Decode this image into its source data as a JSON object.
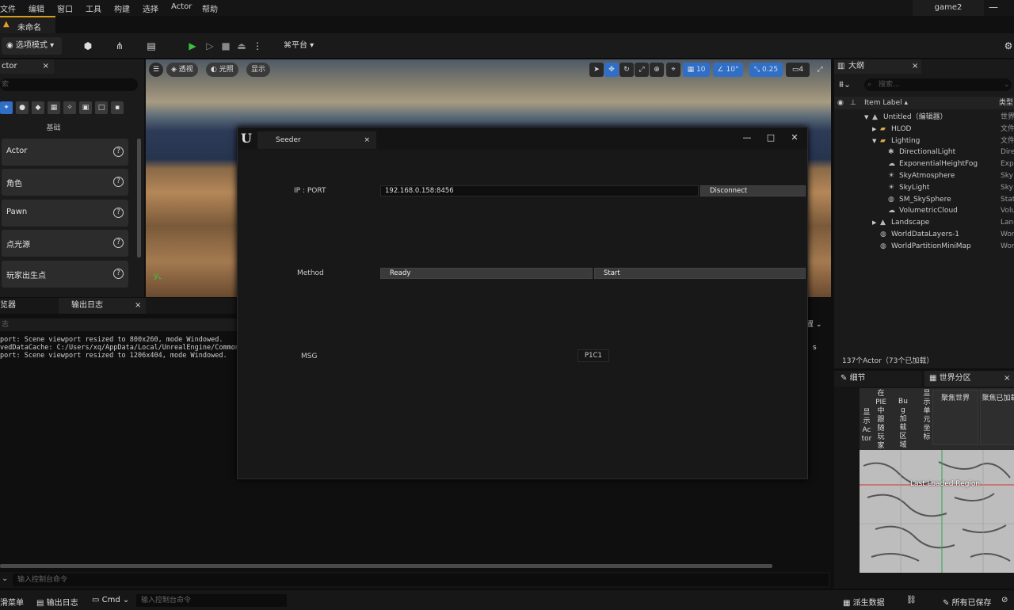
{
  "menubar": {
    "items": [
      "文件",
      "编辑",
      "窗口",
      "工具",
      "构建",
      "选择",
      "Actor",
      "帮助"
    ],
    "project_tab": "game2",
    "minimize": "—"
  },
  "doc_tab": {
    "label": "未命名"
  },
  "toolbar": {
    "mode_label": "选项模式",
    "platform_label": "平台"
  },
  "left_panel": {
    "tab_label": "ctor",
    "search_placeholder": "索",
    "section_label": "基础",
    "items": [
      {
        "label": "Actor"
      },
      {
        "label": "角色"
      },
      {
        "label": "Pawn"
      },
      {
        "label": "点光源"
      },
      {
        "label": "玩家出生点"
      }
    ]
  },
  "viewport": {
    "btn_perspective": "透视",
    "btn_lit": "光照",
    "btn_show": "显示",
    "grid_snap": "10",
    "rot_snap": "10°",
    "scale_snap": "0.25",
    "camera_speed": "4"
  },
  "log": {
    "tab_browser": "览器",
    "tab_output": "输出日志",
    "filter_placeholder": "志",
    "lines": [
      "port: Scene viewport resized to 800x260, mode Windowed.",
      "vedDataCache: C:/Users/xq/AppData/Local/UnrealEngine/Common/",
      "port: Scene viewport resized to 1206x404, mode Windowed."
    ],
    "cmd_placeholder": "输入控制台命令",
    "side_dropdown": "置",
    "side_s": "s"
  },
  "statusbar": {
    "drawer": "滑菜单",
    "output_log": "输出日志",
    "cmd": "Cmd",
    "cmd_placeholder": "输入控制台命令",
    "derived_data": "派生数据",
    "all_saved": "所有已保存"
  },
  "outliner": {
    "tab_label": "大纲",
    "search_placeholder": "搜索...",
    "col_label": "Item Label",
    "col_type": "类型",
    "rows": [
      {
        "indent": 0,
        "arrow": "▼",
        "label": "Untitled（编辑器）",
        "type": "世界"
      },
      {
        "indent": 1,
        "arrow": "▶",
        "label": "HLOD",
        "type": "文件"
      },
      {
        "indent": 1,
        "arrow": "▼",
        "label": "Lighting",
        "type": "文件"
      },
      {
        "indent": 2,
        "arrow": "",
        "label": "DirectionalLight",
        "type": "Dire"
      },
      {
        "indent": 2,
        "arrow": "",
        "label": "ExponentialHeightFog",
        "type": "Expo"
      },
      {
        "indent": 2,
        "arrow": "",
        "label": "SkyAtmosphere",
        "type": "Sky"
      },
      {
        "indent": 2,
        "arrow": "",
        "label": "SkyLight",
        "type": "Sky"
      },
      {
        "indent": 2,
        "arrow": "",
        "label": "SM_SkySphere",
        "type": "Stat"
      },
      {
        "indent": 2,
        "arrow": "",
        "label": "VolumetricCloud",
        "type": "Volu"
      },
      {
        "indent": 1,
        "arrow": "▶",
        "label": "Landscape",
        "type": "Land"
      },
      {
        "indent": 1,
        "arrow": "",
        "label": "WorldDataLayers-1",
        "type": "Wor"
      },
      {
        "indent": 1,
        "arrow": "",
        "label": "WorldPartitionMiniMap",
        "type": "Wor"
      }
    ],
    "count": "137个Actor（73个已加载）"
  },
  "world_partition": {
    "tab_details": "细节",
    "tab_wp": "世界分区",
    "opt_show_actors": "显示Actor",
    "opt_hide_pie": "在PIE中跟随玩家",
    "opt_bugit": "Bug加载区域",
    "opt_show_coords": "显示单元坐标",
    "btn_focus_world": "聚焦世界",
    "btn_focus_loaded": "聚焦已加载",
    "map_label": "Last Loaded Region"
  },
  "seeder": {
    "tab_title": "Seeder",
    "ip_label": "IP : PORT",
    "ip_value": "192.168.0.158:8456",
    "disconnect": "Disconnect",
    "method_label": "Method",
    "ready": "Ready",
    "start": "Start",
    "msg_label": "MSG",
    "msg_value": "P1C1"
  }
}
